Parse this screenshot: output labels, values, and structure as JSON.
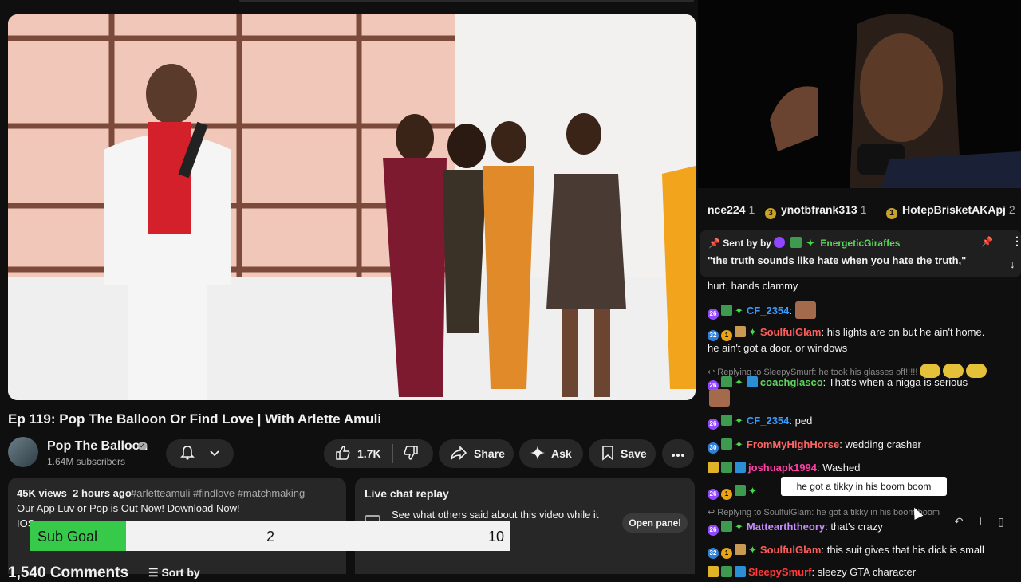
{
  "video": {
    "title": "Ep 119: Pop The Balloon Or Find Love | With Arlette Amuli"
  },
  "channel": {
    "name": "Pop The Balloon",
    "subscribers": "1.64M subscribers"
  },
  "actions": {
    "like_count": "1.7K",
    "share_label": "Share",
    "ask_label": "Ask",
    "save_label": "Save"
  },
  "description": {
    "views": "45K views",
    "age": "2 hours ago",
    "hashtags": "#arletteamuli #findlove #matchmaking",
    "line1": "Our App Luv or Pop is Out Now! Download Now!",
    "line2": "IOS"
  },
  "live_chat": {
    "title": "Live chat replay",
    "text": "See what others said about this video while it",
    "button": "Open panel"
  },
  "comments": {
    "count": "1,540 Comments",
    "sort_label": "Sort by"
  },
  "sub_goal": {
    "label": "Sub Goal",
    "current": "2",
    "target": "10",
    "progress": 0.2
  },
  "leaderboard": [
    {
      "name": "nce224",
      "count": "1"
    },
    {
      "name": "ynotbfrank313",
      "count": "1"
    },
    {
      "name": "HotepBrisketAKApj",
      "count": "2"
    }
  ],
  "pinned": {
    "sent_by": "Sent by",
    "user": "EnergeticGiraffes",
    "message": "\"the truth sounds like hate when you hate the truth,\""
  },
  "chat": [
    {
      "text": "hurt, hands clammy"
    },
    {
      "user": "CF_2354",
      "color": "#3a9bff",
      "text": ""
    },
    {
      "user": "SoulfulGlam",
      "color": "#ff5c5c",
      "text": "his lights are on but he ain't home.",
      "text2": "he ain't got a door. or windows"
    },
    {
      "reply": "Replying to SleepySmurf: he took his glasses off!!!!!"
    },
    {
      "user": "coachglasco",
      "color": "#5fd35f",
      "text": "That's when a nigga is serious"
    },
    {
      "user": "CF_2354",
      "color": "#3a9bff",
      "text": "ped"
    },
    {
      "user": "FromMyHighHorse",
      "color": "#ff6464",
      "text": "wedding crasher"
    },
    {
      "user": "joshuapk1994",
      "color": "#ff3fa4",
      "text": "Washed"
    },
    {
      "reply": "Replying to SoulfulGlam: he got a tikky in his boom boom"
    },
    {
      "user": "Mattearththeory",
      "color": "#c58bff",
      "text": "that's crazy"
    },
    {
      "user": "SoulfulGlam",
      "color": "#ff5c5c",
      "text": "this suit gives that his dick is small"
    },
    {
      "user": "SleepySmurf",
      "color": "#ff3b3b",
      "text": "sleezy GTA character"
    }
  ],
  "tooltip": "he got a tikky in his boom boom",
  "badges": {
    "b1": "26",
    "b2": "32",
    "b3": "30"
  }
}
